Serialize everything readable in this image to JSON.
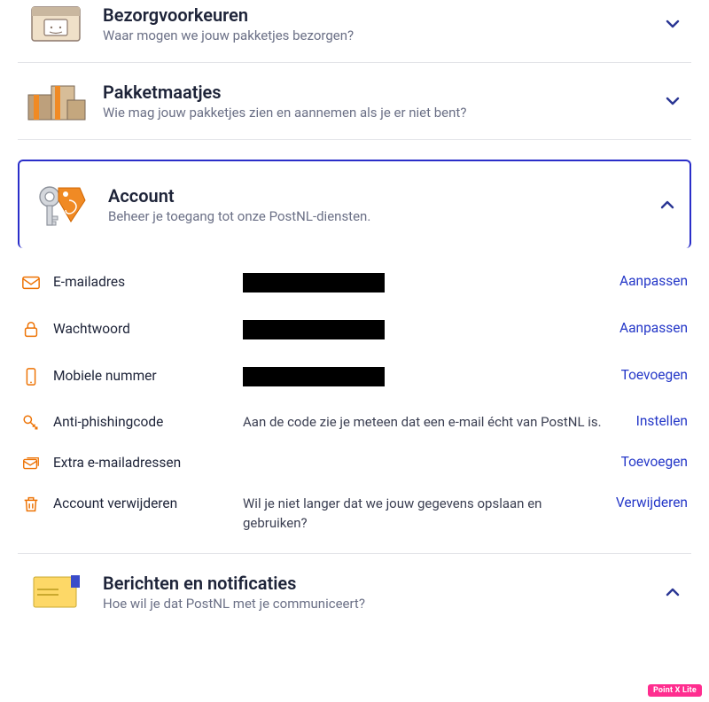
{
  "sections": {
    "delivery": {
      "title": "Bezorgvoorkeuren",
      "subtitle": "Waar mogen we jouw pakketjes bezorgen?"
    },
    "buddies": {
      "title": "Pakketmaatjes",
      "subtitle": "Wie mag jouw pakketjes zien en aannemen als je er niet bent?"
    },
    "account": {
      "title": "Account",
      "subtitle": "Beheer je toegang tot onze PostNL-diensten."
    },
    "messages": {
      "title": "Berichten en notificaties",
      "subtitle": "Hoe wil je dat PostNL met je communiceert?"
    }
  },
  "account_rows": {
    "email": {
      "label": "E-mailadres",
      "action": "Aanpassen"
    },
    "password": {
      "label": "Wachtwoord",
      "action": "Aanpassen"
    },
    "mobile": {
      "label": "Mobiele nummer",
      "action": "Toevoegen"
    },
    "antiphishing": {
      "label": "Anti-phishingcode",
      "desc": "Aan de code zie je meteen dat een e-mail écht van PostNL is.",
      "action": "Instellen"
    },
    "extra_emails": {
      "label": "Extra e-mailadressen",
      "action": "Toevoegen"
    },
    "delete_account": {
      "label": "Account verwijderen",
      "desc": "Wil je niet langer dat we jouw gegevens opslaan en gebruiken?",
      "action": "Verwijderen"
    }
  },
  "watermark": "Point X Lite"
}
